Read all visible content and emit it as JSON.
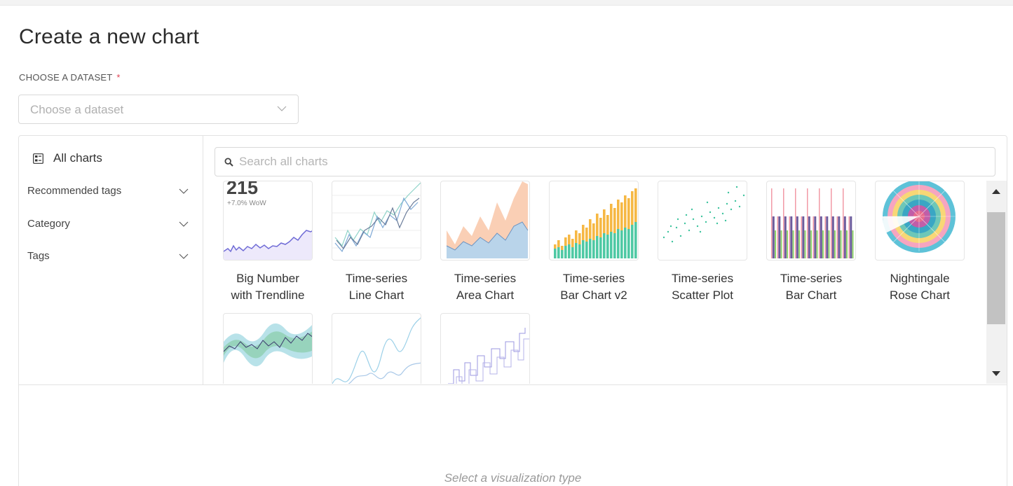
{
  "page": {
    "title": "Create a new chart"
  },
  "dataset": {
    "label": "CHOOSE A DATASET",
    "required_mark": "*",
    "placeholder": "Choose a dataset"
  },
  "sidebar": {
    "all_charts": "All charts",
    "items": [
      {
        "label": "Recommended tags"
      },
      {
        "label": "Category"
      },
      {
        "label": "Tags"
      }
    ]
  },
  "search": {
    "placeholder": "Search all charts"
  },
  "charts": [
    {
      "line1": "Big Number",
      "line2": "with Trendline",
      "thumb": "big-number",
      "big_value": "215",
      "sub_value": "+7.0% WoW"
    },
    {
      "line1": "Time-series",
      "line2": "Line Chart",
      "thumb": "line"
    },
    {
      "line1": "Time-series",
      "line2": "Area Chart",
      "thumb": "area"
    },
    {
      "line1": "Time-series",
      "line2": "Bar Chart v2",
      "thumb": "bar-v2"
    },
    {
      "line1": "Time-series",
      "line2": "Scatter Plot",
      "thumb": "scatter"
    },
    {
      "line1": "Time-series",
      "line2": "Bar Chart",
      "thumb": "bar"
    },
    {
      "line1": "Nightingale",
      "line2": "Rose Chart",
      "thumb": "rose"
    }
  ],
  "charts_row2": [
    {
      "thumb": "band"
    },
    {
      "thumb": "smooth-line"
    },
    {
      "thumb": "step-line"
    }
  ],
  "detail": {
    "empty_message": "Select a visualization type"
  },
  "colors": {
    "accent_purple": "#6f6bd6",
    "required_red": "#e04355"
  }
}
